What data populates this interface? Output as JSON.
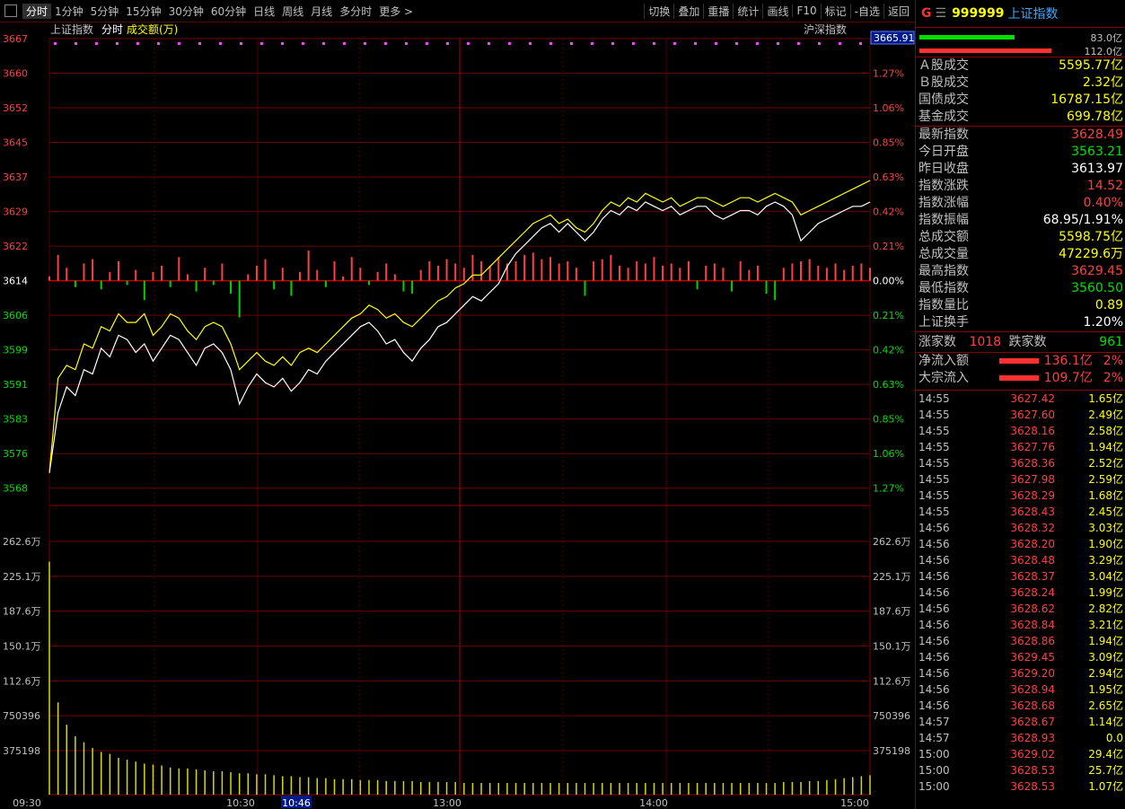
{
  "toolbar": {
    "periods": [
      "分时",
      "1分钟",
      "5分钟",
      "15分钟",
      "30分钟",
      "60分钟",
      "日线",
      "周线",
      "月线",
      "多分时",
      "更多 >"
    ],
    "active_period": 0,
    "tools": [
      "切换",
      "叠加",
      "重播",
      "统计",
      "画线",
      "F10",
      "标记",
      "-自选",
      "返回"
    ]
  },
  "chart_header": {
    "left": "上证指数",
    "mode": "分时",
    "series": "成交额(万)",
    "right": "沪深指数",
    "price_box": "3665.91"
  },
  "chart_data": {
    "type": "line",
    "x_ticks": [
      "09:30",
      "10:30",
      "10:46",
      "13:00",
      "14:00",
      "15:00"
    ],
    "price_axis": [
      "3667",
      "3660",
      "3652",
      "3645",
      "3637",
      "3629",
      "3622",
      "3614",
      "3606",
      "3599",
      "3591",
      "3583",
      "3576",
      "3568"
    ],
    "pct_axis": [
      "1.27%",
      "1.06%",
      "0.85%",
      "0.63%",
      "0.42%",
      "0.21%",
      "0.00%",
      "0.21%",
      "0.42%",
      "0.63%",
      "0.85%",
      "1.06%",
      "1.27%"
    ],
    "vol_axis": [
      "262.6万",
      "225.1万",
      "187.6万",
      "150.1万",
      "112.6万",
      "750396",
      "375198"
    ],
    "ylim": [
      3560.5,
      3667
    ],
    "prev_close": 3613.97,
    "series": [
      {
        "color": "#ffffff",
        "values": [
          3566,
          3580,
          3586,
          3584,
          3590,
          3589,
          3595,
          3593,
          3598,
          3597,
          3594,
          3596,
          3592,
          3595,
          3598,
          3597,
          3594,
          3591,
          3595,
          3596,
          3594,
          3590,
          3582,
          3586,
          3589,
          3587,
          3586,
          3588,
          3585,
          3587,
          3590,
          3589,
          3592,
          3594,
          3596,
          3598,
          3600,
          3601,
          3599,
          3596,
          3597,
          3594,
          3592,
          3595,
          3597,
          3600,
          3601,
          3603,
          3605,
          3607,
          3606,
          3608,
          3610,
          3614,
          3617,
          3619,
          3621,
          3623,
          3624,
          3622,
          3624,
          3622,
          3620,
          3622,
          3625,
          3627,
          3626,
          3628,
          3627,
          3629,
          3628,
          3627,
          3628,
          3626,
          3627,
          3628,
          3628,
          3626,
          3625,
          3626,
          3627,
          3627,
          3626,
          3628,
          3629,
          3628,
          3626,
          3620,
          3622,
          3624,
          3625,
          3626,
          3627,
          3628,
          3628,
          3629
        ]
      },
      {
        "color": "#ffff00",
        "values": [
          3566,
          3588,
          3591,
          3590,
          3596,
          3595,
          3600,
          3599,
          3603,
          3601,
          3601,
          3603,
          3598,
          3600,
          3603,
          3602,
          3599,
          3597,
          3600,
          3601,
          3600,
          3596,
          3590,
          3592,
          3594,
          3592,
          3591,
          3593,
          3591,
          3594,
          3595,
          3594,
          3596,
          3598,
          3600,
          3602,
          3603,
          3605,
          3604,
          3602,
          3603,
          3601,
          3600,
          3602,
          3604,
          3606,
          3607,
          3609,
          3610,
          3612,
          3612,
          3614,
          3616,
          3618,
          3620,
          3622,
          3624,
          3625,
          3626,
          3624,
          3625,
          3623,
          3622,
          3624,
          3627,
          3629,
          3628,
          3630,
          3629,
          3631,
          3630,
          3629,
          3630,
          3628,
          3629,
          3630,
          3630,
          3629,
          3628,
          3629,
          3630,
          3630,
          3629,
          3630,
          3631,
          3630,
          3629,
          3626,
          3627,
          3628,
          3629,
          3630,
          3631,
          3632,
          3633,
          3634
        ]
      }
    ],
    "flow": [
      0.2,
      1.2,
      0.6,
      -0.3,
      0.8,
      1.0,
      -0.4,
      0.4,
      0.9,
      -0.2,
      0.5,
      -0.9,
      0.4,
      0.7,
      -0.3,
      1.1,
      0.3,
      -0.5,
      0.6,
      -0.2,
      0.8,
      -0.6,
      -1.7,
      0.3,
      0.7,
      1.0,
      -0.4,
      0.6,
      -0.7,
      0.4,
      1.4,
      0.5,
      -0.3,
      0.9,
      0.2,
      1.1,
      0.6,
      -0.2,
      0.4,
      0.8,
      0.3,
      -0.5,
      -0.6,
      0.5,
      0.9,
      0.7,
      1.0,
      0.8,
      0.6,
      1.2,
      0.9,
      0.7,
      1.1,
      0.8,
      0.9,
      1.2,
      1.3,
      1.0,
      1.1,
      0.8,
      0.9,
      0.6,
      -0.7,
      0.9,
      1.0,
      1.2,
      0.7,
      0.6,
      0.9,
      0.8,
      1.1,
      0.7,
      0.8,
      0.6,
      0.9,
      -0.4,
      0.7,
      0.8,
      0.6,
      -0.5,
      0.9,
      0.5,
      0.7,
      -0.6,
      -0.9,
      0.6,
      0.8,
      0.9,
      1.0,
      0.7,
      0.6,
      0.8,
      0.5,
      0.7,
      0.8,
      0.6
    ],
    "volume": [
      240,
      95,
      72,
      60,
      54,
      48,
      44,
      42,
      38,
      36,
      34,
      32,
      31,
      30,
      28,
      27,
      27,
      26,
      25,
      24,
      24,
      23,
      22,
      22,
      21,
      21,
      20,
      19,
      19,
      18,
      18,
      17,
      17,
      16,
      16,
      16,
      15,
      15,
      15,
      14,
      14,
      14,
      14,
      13,
      13,
      13,
      13,
      13,
      12,
      12,
      12,
      12,
      12,
      12,
      12,
      12,
      12,
      12,
      12,
      12,
      12,
      12,
      12,
      12,
      12,
      12,
      12,
      12,
      12,
      12,
      12,
      12,
      12,
      12,
      12,
      12,
      12,
      12,
      12,
      12,
      12,
      12,
      12,
      12,
      12,
      13,
      13,
      13,
      14,
      14,
      15,
      16,
      17,
      18,
      19,
      20
    ]
  },
  "header": {
    "g": "G",
    "menu": "☰",
    "code": "999999",
    "name": "上证指数"
  },
  "bars": {
    "top_value": "83.0亿",
    "bottom_value": "112.0亿",
    "top_pct": 0.46,
    "bottom_pct": 0.64
  },
  "summary": [
    {
      "label": "Ａ股成交",
      "value": "5595.77亿",
      "cls": "y"
    },
    {
      "label": "Ｂ股成交",
      "value": "2.32亿",
      "cls": "y"
    },
    {
      "label": "国债成交",
      "value": "16787.15亿",
      "cls": "y"
    },
    {
      "label": "基金成交",
      "value": "699.78亿",
      "cls": "y"
    }
  ],
  "stats": [
    {
      "label": "最新指数",
      "value": "3628.49",
      "cls": "r"
    },
    {
      "label": "今日开盘",
      "value": "3563.21",
      "cls": "gr"
    },
    {
      "label": "昨日收盘",
      "value": "3613.97",
      "cls": "w"
    },
    {
      "label": "指数涨跌",
      "value": "14.52",
      "cls": "r"
    },
    {
      "label": "指数涨幅",
      "value": "0.40%",
      "cls": "r"
    },
    {
      "label": "指数振幅",
      "value": "68.95/1.91%",
      "cls": "w"
    },
    {
      "label": "总成交额",
      "value": "5598.75亿",
      "cls": "y"
    },
    {
      "label": "总成交量",
      "value": "47229.6万",
      "cls": "y"
    },
    {
      "label": "最高指数",
      "value": "3629.45",
      "cls": "r"
    },
    {
      "label": "最低指数",
      "value": "3560.50",
      "cls": "gr"
    },
    {
      "label": "指数量比",
      "value": "0.89",
      "cls": "y"
    },
    {
      "label": "上证换手",
      "value": "1.20%",
      "cls": "w"
    }
  ],
  "breadth": {
    "up_label": "涨家数",
    "up": "1018",
    "down_label": "跌家数",
    "down": "961"
  },
  "flows": [
    {
      "label": "净流入额",
      "value": "136.1亿",
      "pct": "2%"
    },
    {
      "label": "大宗流入",
      "value": "109.7亿",
      "pct": "2%"
    }
  ],
  "ticks": [
    {
      "t": "14:55",
      "p": "3627.42",
      "q": "1.65亿"
    },
    {
      "t": "14:55",
      "p": "3627.60",
      "q": "2.49亿"
    },
    {
      "t": "14:55",
      "p": "3628.16",
      "q": "2.58亿"
    },
    {
      "t": "14:55",
      "p": "3627.76",
      "q": "1.94亿"
    },
    {
      "t": "14:55",
      "p": "3628.36",
      "q": "2.52亿"
    },
    {
      "t": "14:55",
      "p": "3627.98",
      "q": "2.59亿"
    },
    {
      "t": "14:55",
      "p": "3628.29",
      "q": "1.68亿"
    },
    {
      "t": "14:55",
      "p": "3628.43",
      "q": "2.45亿"
    },
    {
      "t": "14:56",
      "p": "3628.32",
      "q": "3.03亿"
    },
    {
      "t": "14:56",
      "p": "3628.20",
      "q": "1.90亿"
    },
    {
      "t": "14:56",
      "p": "3628.48",
      "q": "3.29亿"
    },
    {
      "t": "14:56",
      "p": "3628.37",
      "q": "3.04亿"
    },
    {
      "t": "14:56",
      "p": "3628.24",
      "q": "1.99亿"
    },
    {
      "t": "14:56",
      "p": "3628.62",
      "q": "2.82亿"
    },
    {
      "t": "14:56",
      "p": "3628.84",
      "q": "3.21亿"
    },
    {
      "t": "14:56",
      "p": "3628.86",
      "q": "1.94亿"
    },
    {
      "t": "14:56",
      "p": "3629.45",
      "q": "3.09亿"
    },
    {
      "t": "14:56",
      "p": "3629.20",
      "q": "2.94亿"
    },
    {
      "t": "14:56",
      "p": "3628.94",
      "q": "1.95亿"
    },
    {
      "t": "14:56",
      "p": "3628.68",
      "q": "2.65亿"
    },
    {
      "t": "14:57",
      "p": "3628.67",
      "q": "1.14亿"
    },
    {
      "t": "14:57",
      "p": "3628.93",
      "q": "0.0"
    },
    {
      "t": "15:00",
      "p": "3629.02",
      "q": "29.4亿"
    },
    {
      "t": "15:00",
      "p": "3628.53",
      "q": "25.7亿"
    },
    {
      "t": "15:00",
      "p": "3628.53",
      "q": "1.07亿"
    }
  ]
}
